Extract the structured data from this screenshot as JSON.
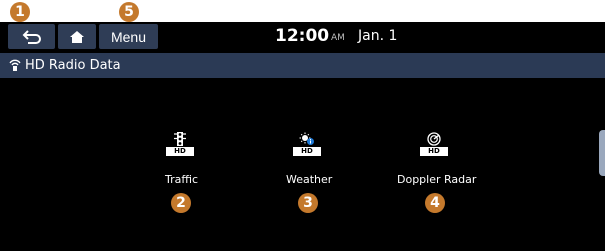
{
  "callouts": [
    "1",
    "5",
    "2",
    "3",
    "4"
  ],
  "topbar": {
    "back_icon": "back-arrow-icon",
    "home_icon": "home-icon",
    "menu_label": "Menu",
    "time": "12:00",
    "ampm": "AM",
    "date": "Jan. 1"
  },
  "titlebar": {
    "icon": "radio-data-icon",
    "title": "HD Radio Data"
  },
  "items": [
    {
      "label": "Traffic",
      "icon": "traffic-light-icon",
      "badge": "HD"
    },
    {
      "label": "Weather",
      "icon": "weather-icon",
      "badge": "HD"
    },
    {
      "label": "Doppler Radar",
      "icon": "radar-icon",
      "badge": "HD"
    }
  ],
  "colors": {
    "callout": "#c4792c",
    "button_bg": "#2f3d56",
    "titlebar_bg": "#2b3a55",
    "screen_bg": "#000000"
  }
}
